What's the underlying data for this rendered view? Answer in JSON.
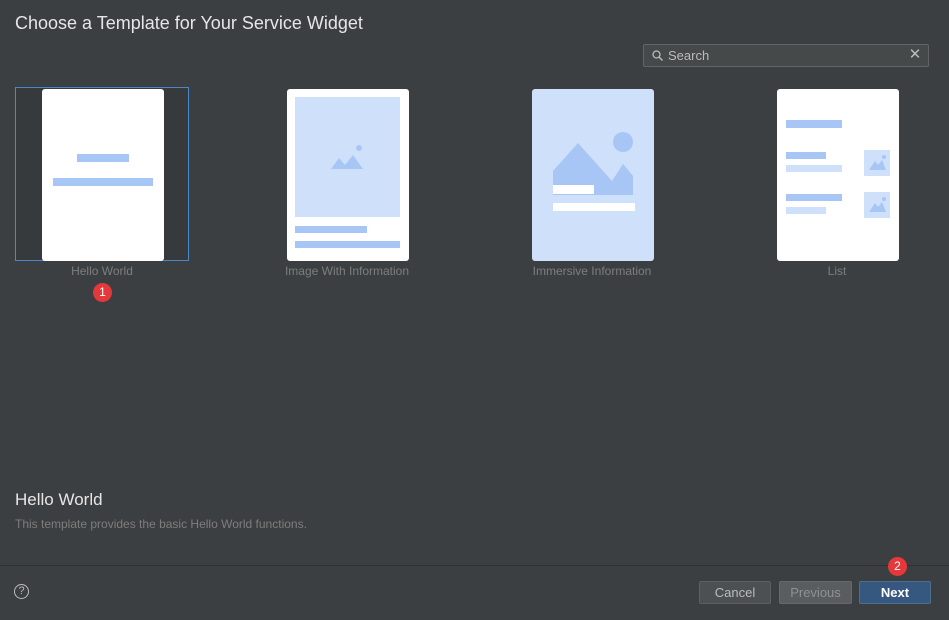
{
  "dialog": {
    "title": "Choose a Template for Your Service Widget"
  },
  "search": {
    "placeholder": "Search",
    "value": ""
  },
  "templates": [
    {
      "label": "Hello World",
      "selected": true
    },
    {
      "label": "Image With Information",
      "selected": false
    },
    {
      "label": "Immersive Information",
      "selected": false
    },
    {
      "label": "List",
      "selected": false
    }
  ],
  "badges": [
    "1",
    "2"
  ],
  "description": {
    "title": "Hello World",
    "text": "This template provides the basic Hello World functions."
  },
  "footer": {
    "help_glyph": "?",
    "cancel_label": "Cancel",
    "previous_label": "Previous",
    "next_label": "Next"
  },
  "colors": {
    "background": "#3c3f41",
    "accent": "#4a88c7",
    "thumb_blue": "#a8c6f5",
    "badge": "#e5383b",
    "primary_button": "#365880"
  }
}
